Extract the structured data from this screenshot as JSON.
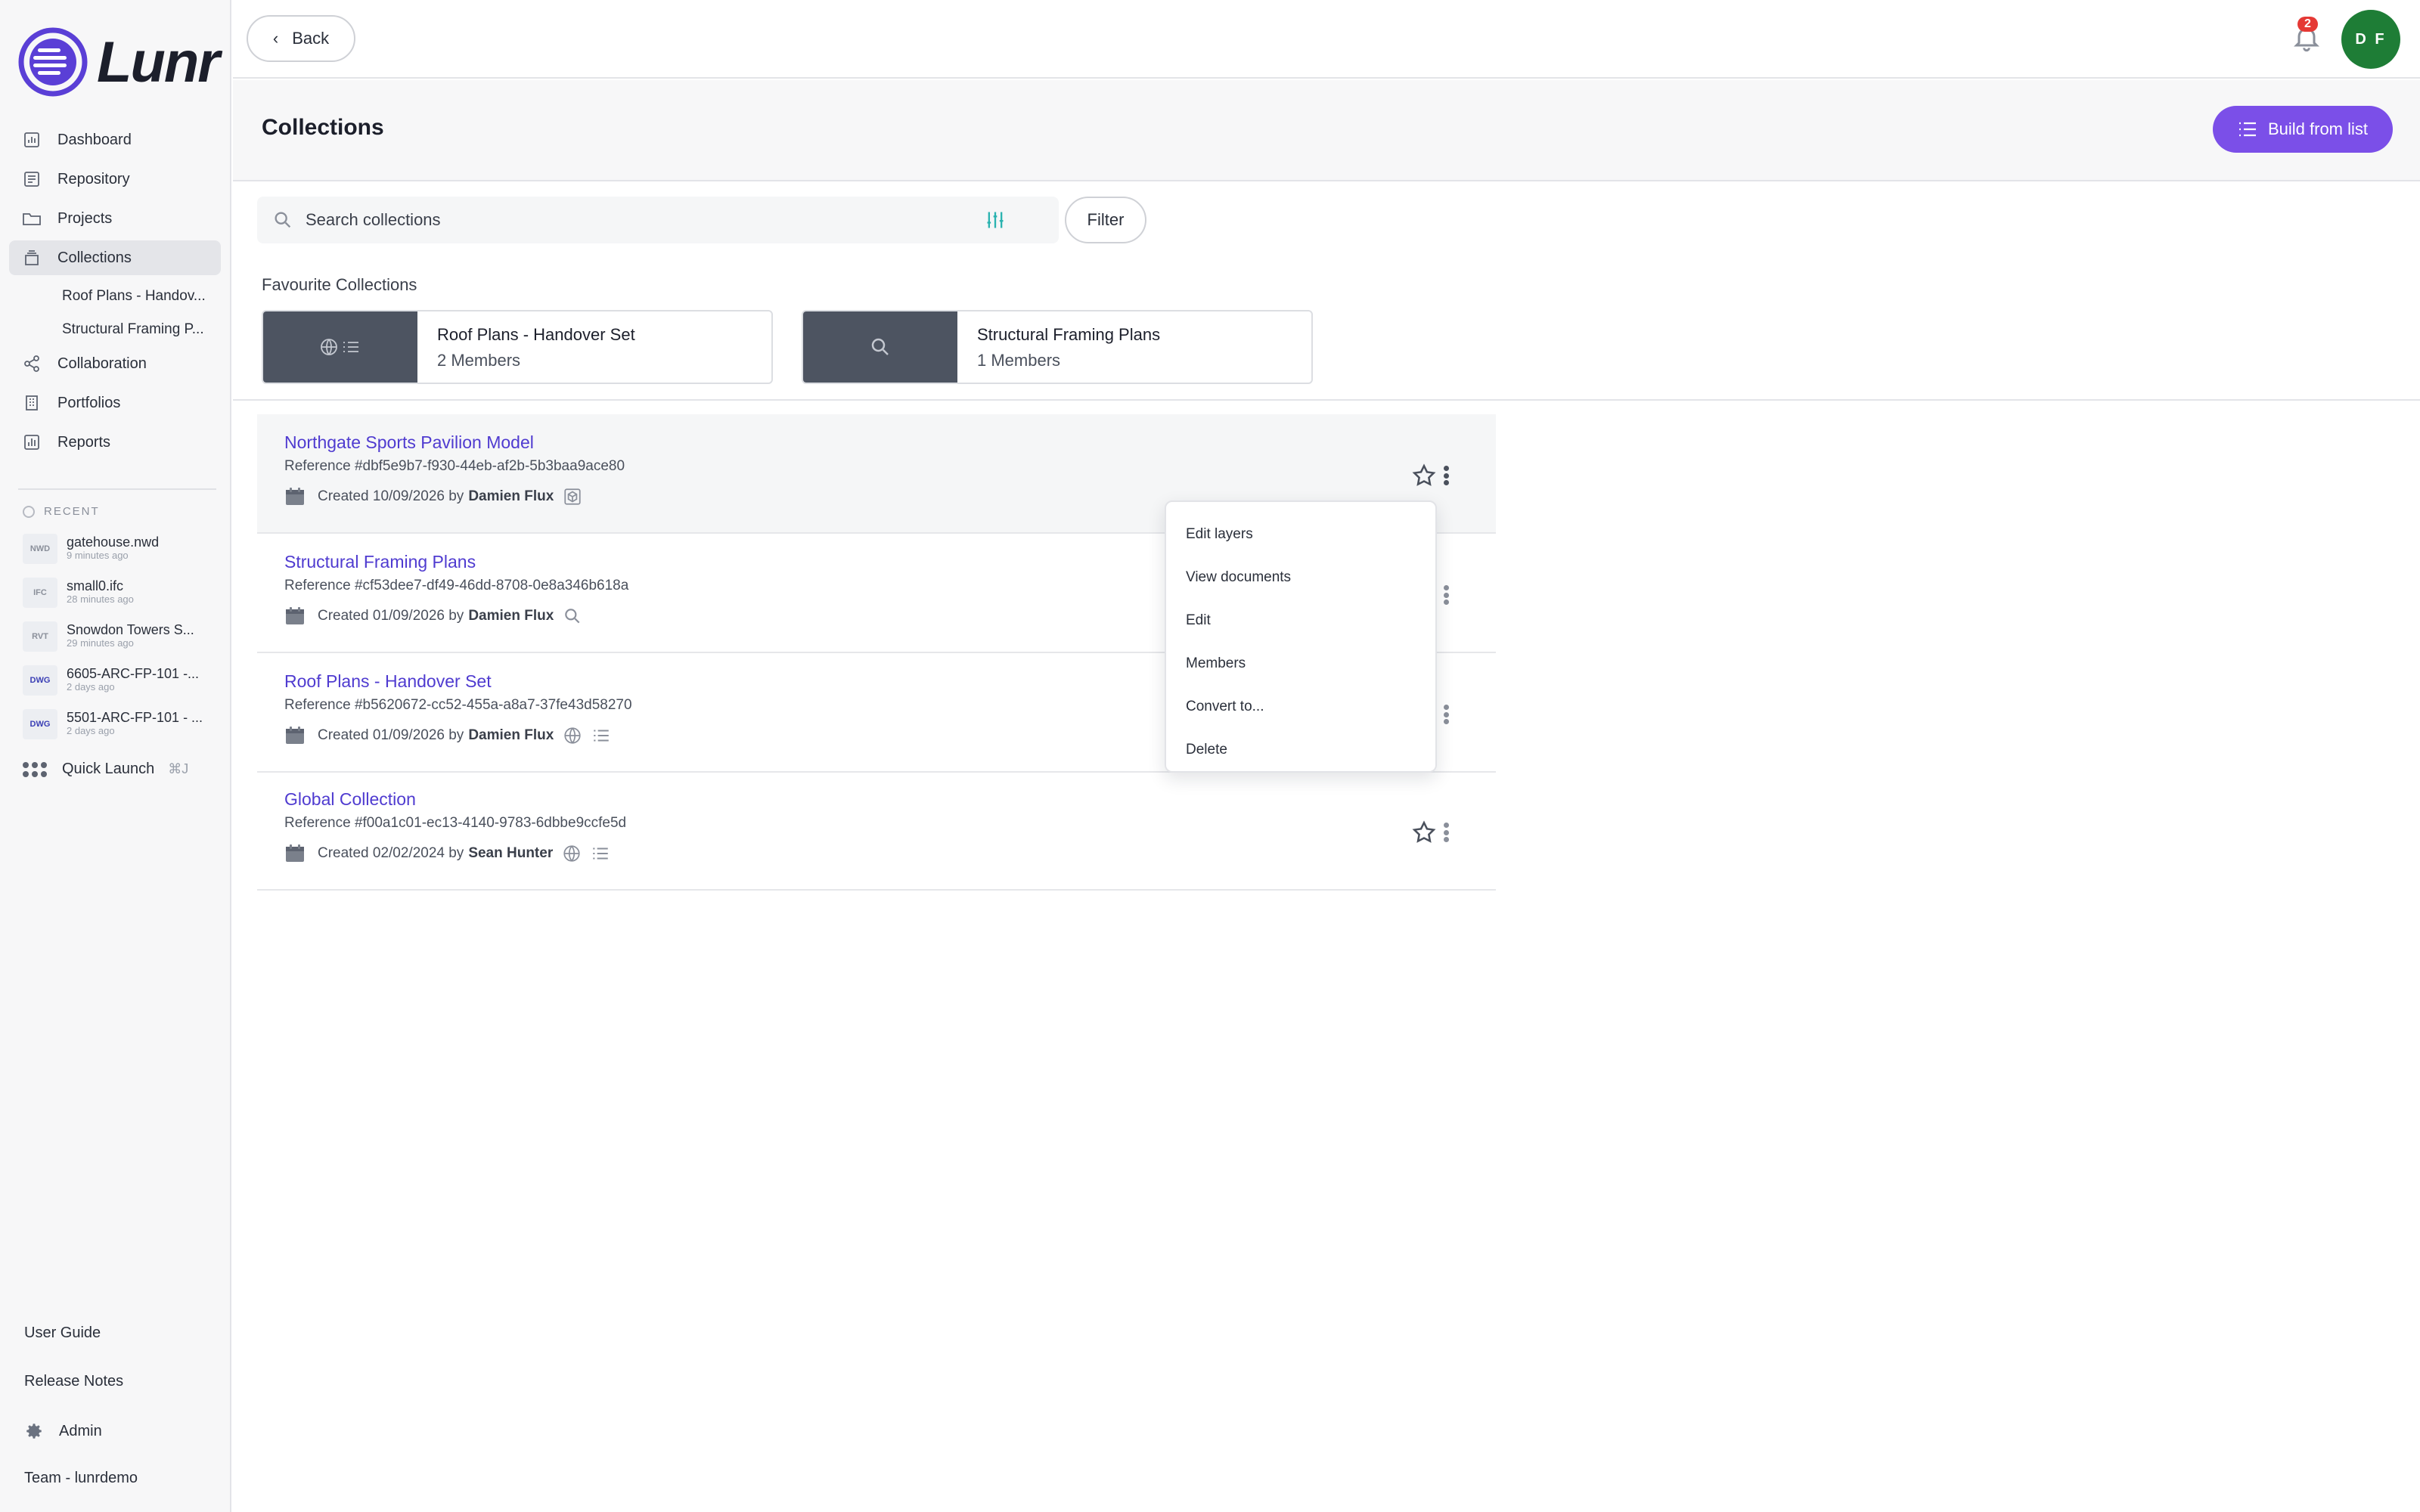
{
  "brand": {
    "name": "Lunr"
  },
  "sidebar": {
    "nav": [
      {
        "label": "Dashboard",
        "icon": "chart-icon"
      },
      {
        "label": "Repository",
        "icon": "repository-icon"
      },
      {
        "label": "Projects",
        "icon": "folder-icon"
      },
      {
        "label": "Collections",
        "icon": "collections-icon"
      }
    ],
    "sub": [
      {
        "label": "Roof Plans - Handov..."
      },
      {
        "label": "Structural Framing P..."
      }
    ],
    "nav2": [
      {
        "label": "Collaboration",
        "icon": "share-icon"
      },
      {
        "label": "Portfolios",
        "icon": "building-icon"
      },
      {
        "label": "Reports",
        "icon": "bar-chart-icon"
      }
    ],
    "recent_title": "RECENT",
    "recent": [
      {
        "type": "NWD",
        "name": "gatehouse.nwd",
        "time": "9 minutes ago"
      },
      {
        "type": "IFC",
        "name": "small0.ifc",
        "time": "28 minutes ago"
      },
      {
        "type": "RVT",
        "name": "Snowdon Towers S...",
        "time": "29 minutes ago"
      },
      {
        "type": "DWG",
        "name": "6605-ARC-FP-101 -...",
        "time": "2 days ago"
      },
      {
        "type": "DWG",
        "name": "5501-ARC-FP-101 - ...",
        "time": "2 days ago"
      }
    ],
    "quick_launch": {
      "label": "Quick Launch",
      "shortcut": "⌘J"
    },
    "footer": {
      "user_guide": "User Guide",
      "release_notes": "Release Notes",
      "admin": "Admin",
      "team": "Team - lunrdemo"
    }
  },
  "topbar": {
    "back": "Back",
    "notifications": "2",
    "avatar_initials": "D F"
  },
  "page": {
    "title": "Collections",
    "build_button": "Build from list",
    "search_placeholder": "Search collections",
    "filter": "Filter",
    "favourites_label": "Favourite Collections",
    "favourites": [
      {
        "name": "Roof Plans - Handover Set",
        "members": "2 Members"
      },
      {
        "name": "Structural Framing Plans",
        "members": "1 Members"
      }
    ]
  },
  "collections": [
    {
      "title": "Northgate Sports Pavilion Model",
      "reference": "Reference #dbf5e9b7-f930-44eb-af2b-5b3baa9ace80",
      "created": "Created 10/09/2026 by",
      "author": "Damien Flux"
    },
    {
      "title": "Structural Framing Plans",
      "reference": "Reference #cf53dee7-df49-46dd-8708-0e8a346b618a",
      "created": "Created 01/09/2026 by",
      "author": "Damien Flux"
    },
    {
      "title": "Roof Plans - Handover Set",
      "reference": "Reference #b5620672-cc52-455a-a8a7-37fe43d58270",
      "created": "Created 01/09/2026 by",
      "author": "Damien Flux"
    },
    {
      "title": "Global Collection",
      "reference": "Reference #f00a1c01-ec13-4140-9783-6dbbe9ccfe5d",
      "created": "Created 02/02/2024 by",
      "author": "Sean Hunter"
    }
  ],
  "menu": [
    "Edit layers",
    "View documents",
    "Edit",
    "Members",
    "Convert to...",
    "Delete"
  ],
  "colors": {
    "accent": "#7b4fe8",
    "link": "#4f3bd0",
    "avatar": "#1e7d36",
    "badge": "#e53935"
  }
}
